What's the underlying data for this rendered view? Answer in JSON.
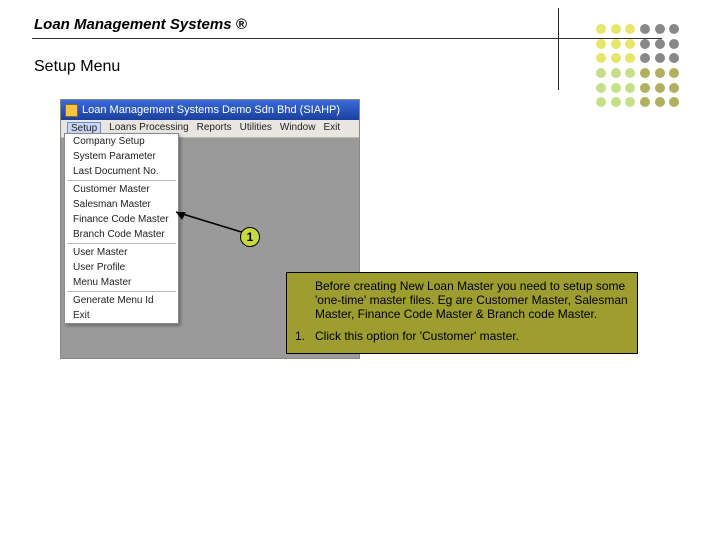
{
  "header": {
    "title": "Loan Management Systems ®",
    "subtitle": "Setup Menu"
  },
  "window": {
    "titlebar_text": "Loan Management Systems   Demo Sdn Bhd (SIAHP)",
    "menubar": {
      "setup": "Setup",
      "loans": "Loans Processing",
      "reports": "Reports",
      "utilities": "Utilities",
      "window": "Window",
      "exit": "Exit"
    },
    "dropdown": {
      "company_setup": "Company Setup",
      "system_parameter": "System Parameter",
      "last_document_no": "Last Document No.",
      "customer_master": "Customer Master",
      "salesman_master": "Salesman Master",
      "finance_code_master": "Finance Code Master",
      "branch_code_master": "Branch Code Master",
      "user_master": "User Master",
      "user_profile": "User Profile",
      "menu_master": "Menu Master",
      "generate_menu_id": "Generate Menu Id",
      "exit": "Exit"
    }
  },
  "callout": {
    "num": "1"
  },
  "note": {
    "intro": "Before creating New Loan Master you need to setup some 'one-time' master files. Eg are Customer Master, Salesman Master, Finance Code Master & Branch code Master.",
    "step_num": "1.",
    "step_text": "Click this option for 'Customer' master."
  }
}
